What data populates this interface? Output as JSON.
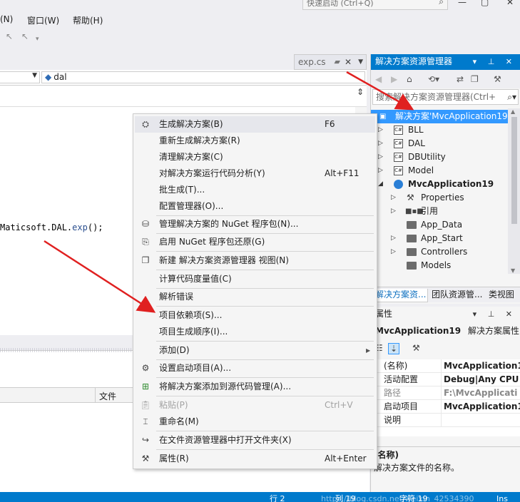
{
  "menubar": {
    "items": [
      "(N)",
      "窗口(W)",
      "帮助(H)"
    ],
    "quick_launch_placeholder": "快速启动 (Ctrl+Q)"
  },
  "editor": {
    "tab_label": "exp.cs",
    "nav_member": "dal",
    "code_prefix": "Maticsoft.DAL.",
    "code_fn": "exp",
    "code_suffix": "();",
    "lower_column_header": "文件"
  },
  "solution_explorer": {
    "title": "解决方案资源管理器",
    "search_placeholder": "搜索解决方案资源管理器(Ctrl+",
    "tree": [
      {
        "label": "解决方案'MvcApplication19",
        "level": 0,
        "icon": "solution",
        "selected": true,
        "expander": "none"
      },
      {
        "label": "BLL",
        "level": 1,
        "icon": "csharp-project",
        "expander": "collapsed"
      },
      {
        "label": "DAL",
        "level": 1,
        "icon": "csharp-project",
        "expander": "collapsed"
      },
      {
        "label": "DBUtility",
        "level": 1,
        "icon": "csharp-project",
        "expander": "collapsed"
      },
      {
        "label": "Model",
        "level": 1,
        "icon": "csharp-project",
        "expander": "collapsed"
      },
      {
        "label": "MvcApplication19",
        "level": 1,
        "icon": "web-project",
        "expander": "expanded",
        "bold": true
      },
      {
        "label": "Properties",
        "level": 2,
        "icon": "wrench",
        "expander": "collapsed"
      },
      {
        "label": "引用",
        "level": 2,
        "icon": "references",
        "expander": "collapsed"
      },
      {
        "label": "App_Data",
        "level": 2,
        "icon": "folder",
        "expander": "none"
      },
      {
        "label": "App_Start",
        "level": 2,
        "icon": "folder",
        "expander": "collapsed"
      },
      {
        "label": "Controllers",
        "level": 2,
        "icon": "folder",
        "expander": "collapsed"
      },
      {
        "label": "Models",
        "level": 2,
        "icon": "folder",
        "expander": "none"
      }
    ],
    "tabs": [
      "解决方案资...",
      "团队资源管...",
      "类视图"
    ]
  },
  "properties": {
    "title": "属性",
    "object_name": "MvcApplication19",
    "object_type": "解决方案属性",
    "rows": [
      {
        "key": "(名称)",
        "value": "MvcApplication1",
        "grey": false
      },
      {
        "key": "活动配置",
        "value": "Debug|Any CPU",
        "grey": false
      },
      {
        "key": "路径",
        "value": "F:\\MvcApplicati",
        "grey": true
      },
      {
        "key": "启动项目",
        "value": "MvcApplication1",
        "grey": false
      },
      {
        "key": "说明",
        "value": "",
        "grey": false
      }
    ],
    "desc_title": "(名称)",
    "desc_text": "解决方案文件的名称。"
  },
  "context_menu": {
    "items": [
      {
        "label": "生成解决方案(B)",
        "shortcut": "F6",
        "icon": "build",
        "hover": true
      },
      {
        "label": "重新生成解决方案(R)",
        "shortcut": ""
      },
      {
        "label": "清理解决方案(C)",
        "shortcut": ""
      },
      {
        "label": "对解决方案运行代码分析(Y)",
        "shortcut": "Alt+F11"
      },
      {
        "label": "批生成(T)...",
        "shortcut": ""
      },
      {
        "label": "配置管理器(O)...",
        "shortcut": ""
      },
      {
        "label": "管理解决方案的 NuGet 程序包(N)...",
        "shortcut": "",
        "icon": "nuget"
      },
      {
        "label": "启用 NuGet 程序包还原(G)",
        "shortcut": "",
        "icon": "restore"
      },
      {
        "label": "新建 解决方案资源管理器 视图(N)",
        "shortcut": "",
        "icon": "new-view"
      },
      {
        "label": "计算代码度量值(C)",
        "shortcut": ""
      },
      {
        "label": "解析错误",
        "shortcut": ""
      },
      {
        "label": "项目依赖项(S)...",
        "shortcut": ""
      },
      {
        "label": "项目生成顺序(I)...",
        "shortcut": ""
      },
      {
        "label": "添加(D)",
        "shortcut": "",
        "submenu": true
      },
      {
        "label": "设置启动项目(A)...",
        "shortcut": "",
        "icon": "gear"
      },
      {
        "label": "将解决方案添加到源代码管理(A)...",
        "shortcut": "",
        "icon": "source-control"
      },
      {
        "label": "粘贴(P)",
        "shortcut": "Ctrl+V",
        "icon": "paste",
        "disabled": true
      },
      {
        "label": "重命名(M)",
        "shortcut": "",
        "icon": "rename"
      },
      {
        "label": "在文件资源管理器中打开文件夹(X)",
        "shortcut": "",
        "icon": "open-folder"
      },
      {
        "label": "属性(R)",
        "shortcut": "Alt+Enter",
        "icon": "wrench"
      }
    ]
  },
  "statusbar": {
    "line": "行 2",
    "col": "列 19",
    "char": "字符 19",
    "mode": "Ins",
    "watermark": "https://blog.csdn.net/weixin_42534390"
  },
  "colors": {
    "accent": "#007acc",
    "selection": "#3399ff",
    "annotation_arrow": "#e02020"
  }
}
